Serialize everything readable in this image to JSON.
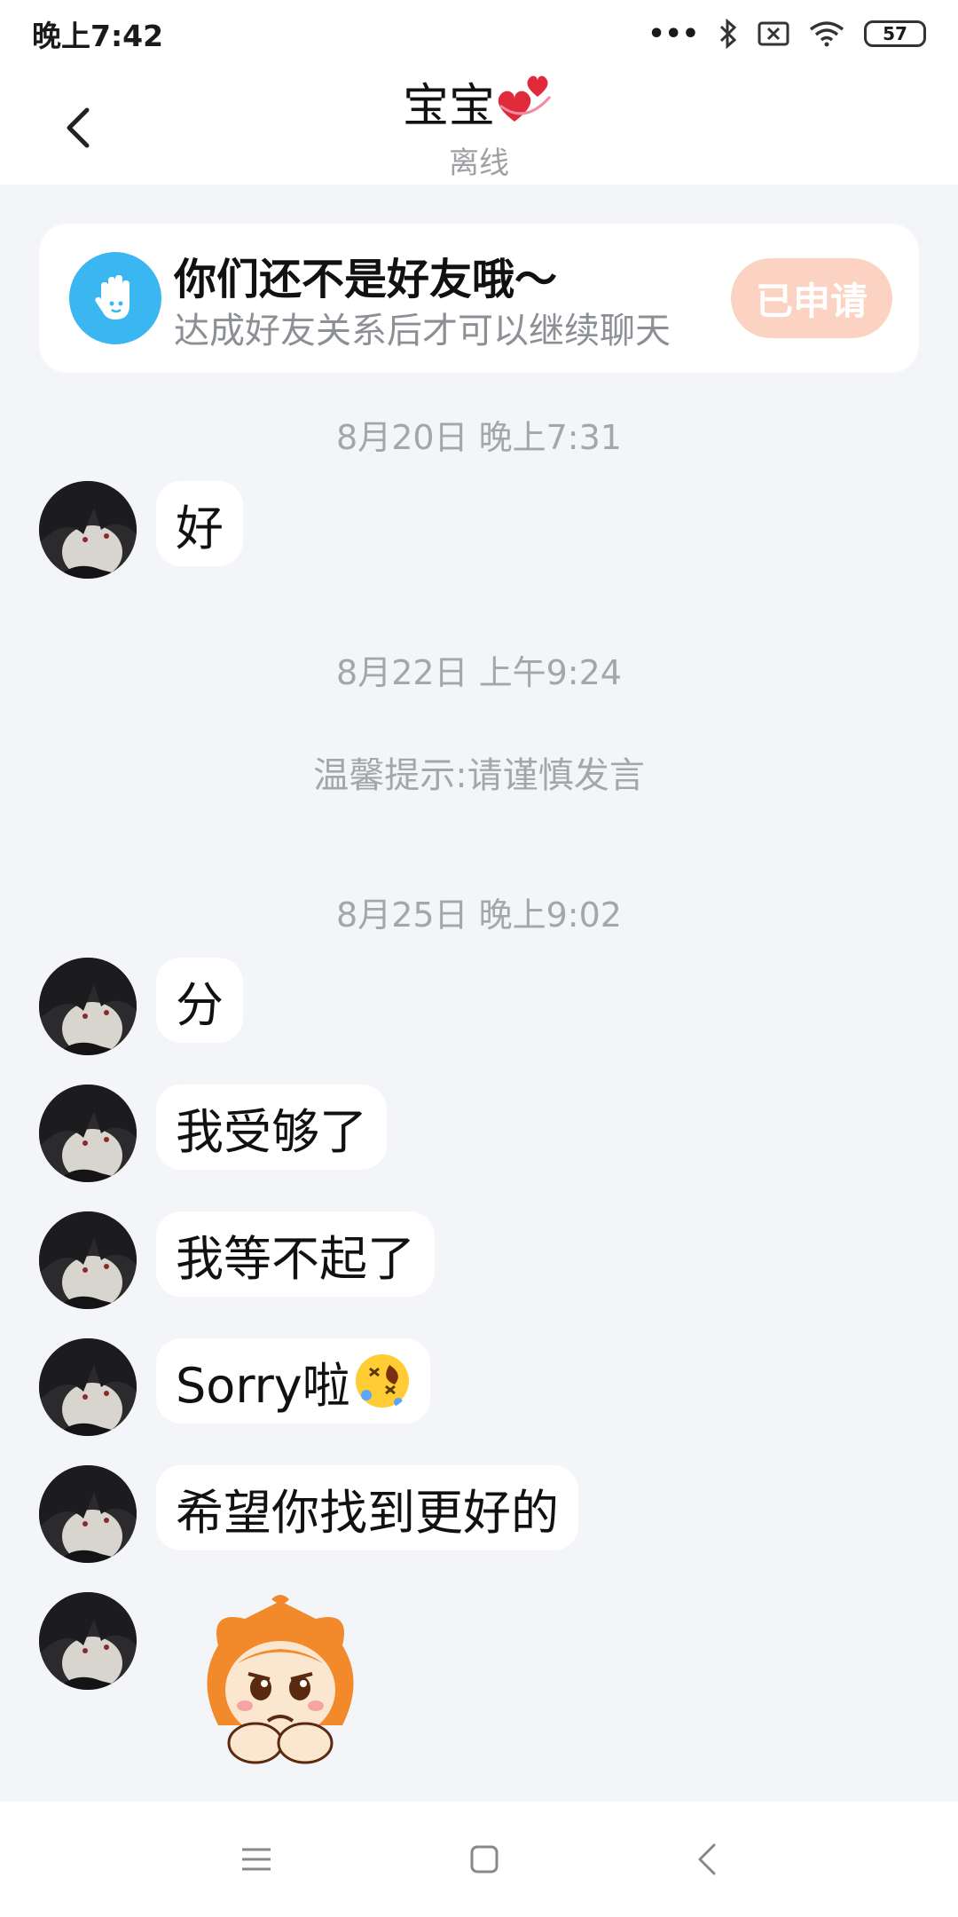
{
  "status_bar": {
    "time": "晚上7:42",
    "battery": "57"
  },
  "header": {
    "title": "宝宝",
    "subtitle": "离线"
  },
  "friend_banner": {
    "title": "你们还不是好友哦～",
    "description": "达成好友关系后才可以继续聊天",
    "button_label": "已申请"
  },
  "messages": {
    "ts1": "8月20日 晚上7:31",
    "m1": "好",
    "ts2": "8月22日 上午9:24",
    "tip": "温馨提示:请谨慎发言",
    "ts3": "8月25日 晚上9:02",
    "m2": "分",
    "m3": "我受够了",
    "m4": "我等不起了",
    "m5": "Sorry啦",
    "m6": "希望你找到更好的"
  },
  "colors": {
    "accent_blue": "#3ab7f0",
    "applied_button": "#fcd3c3",
    "background": "#f3f5f8"
  }
}
